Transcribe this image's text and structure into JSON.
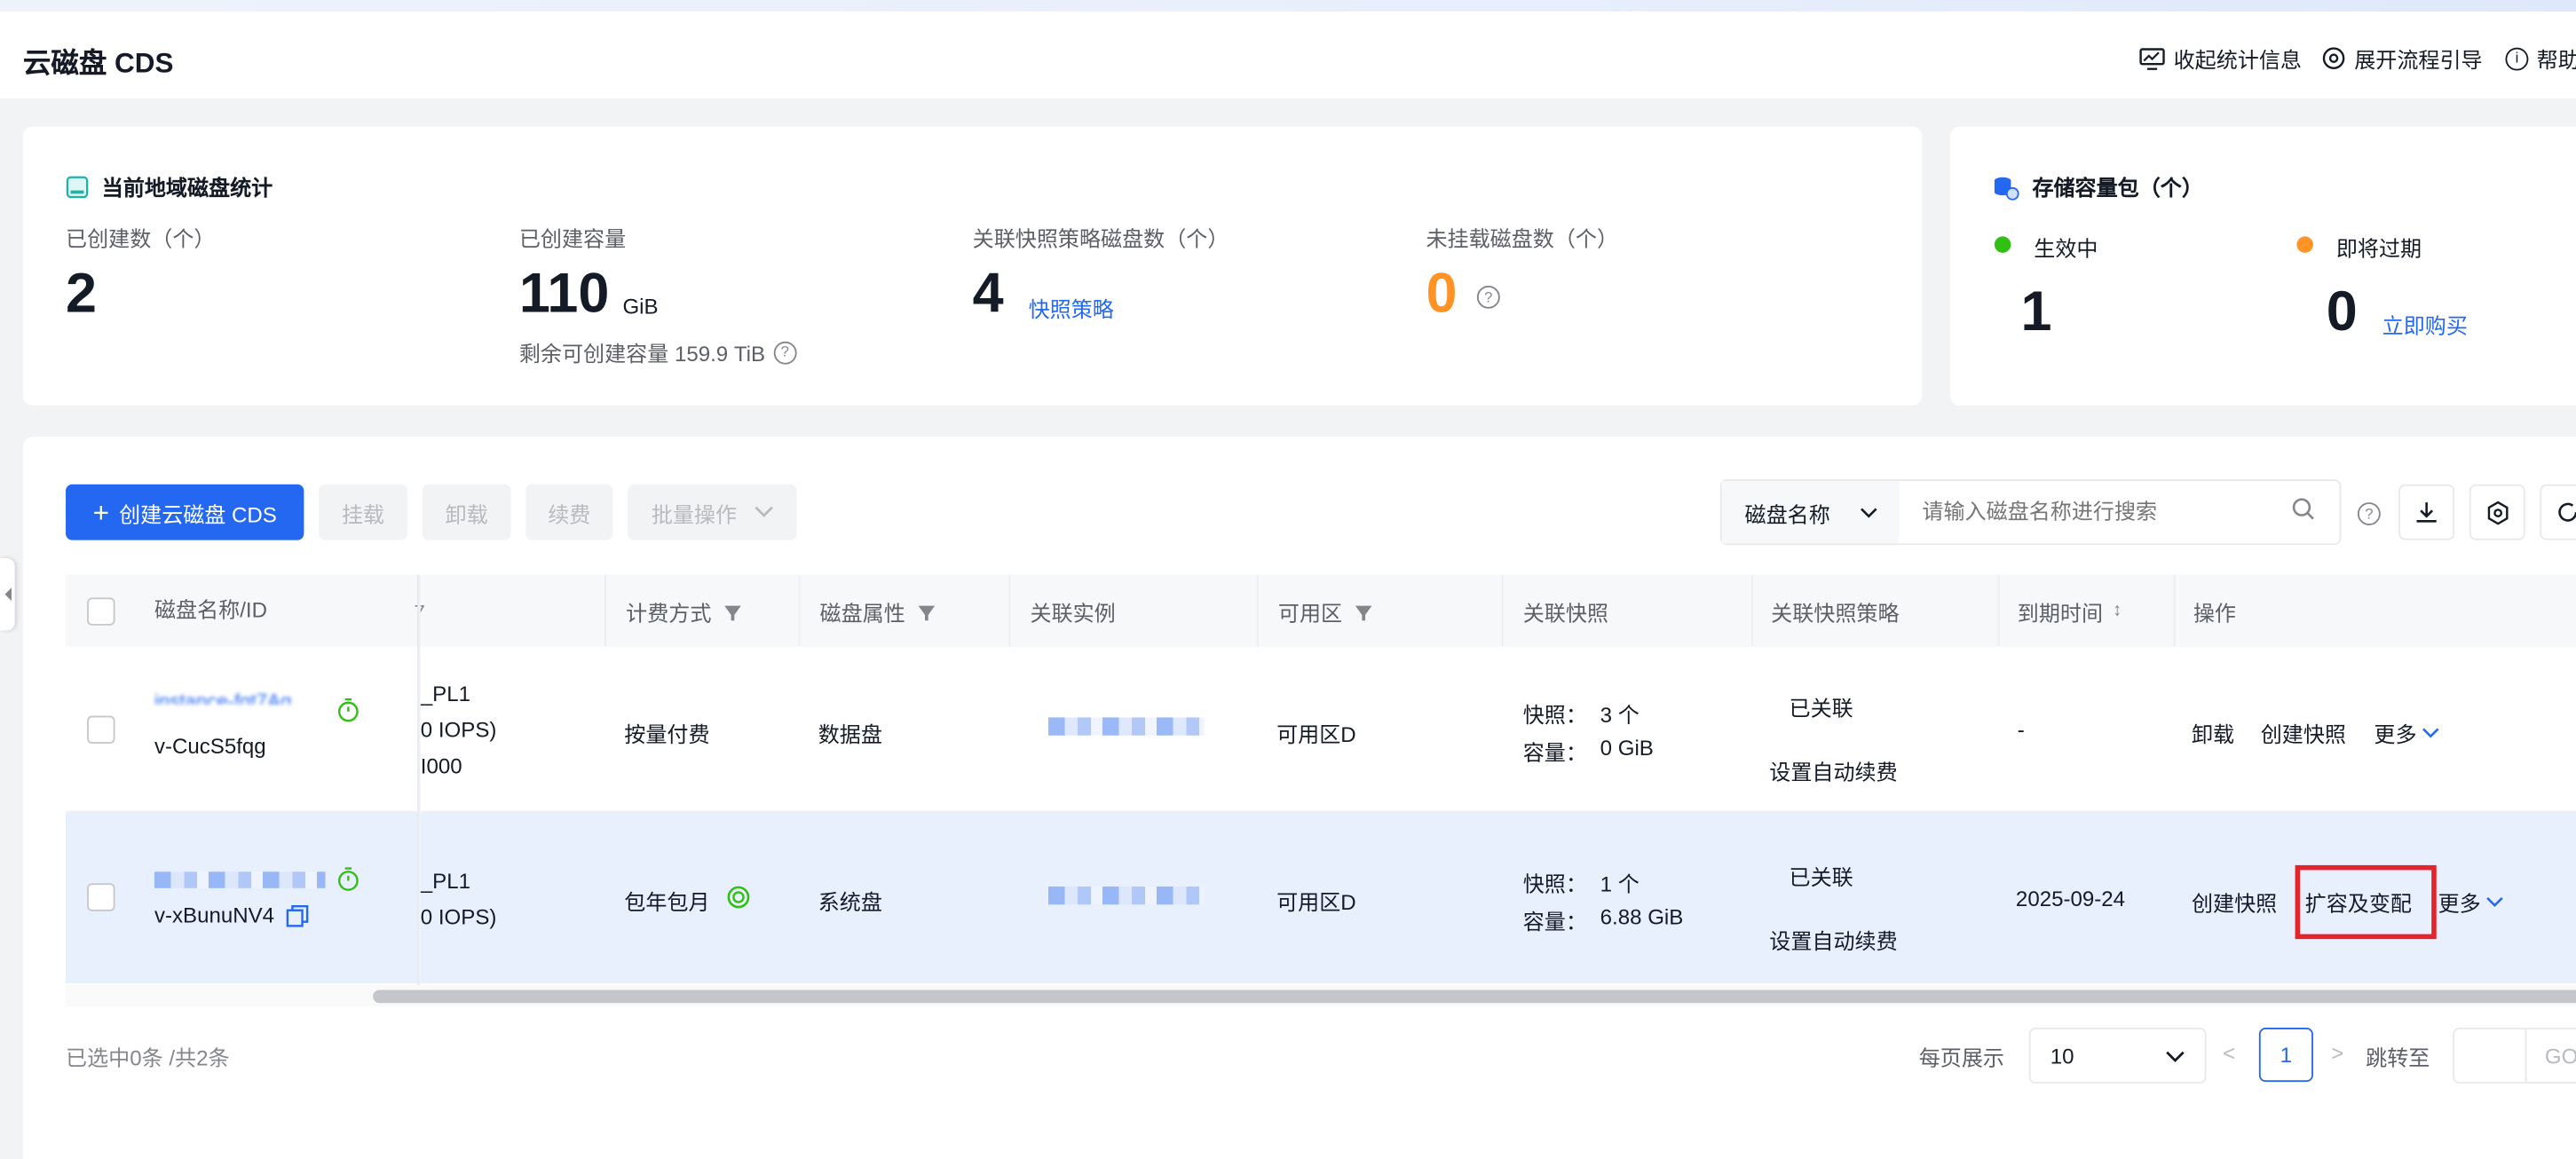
{
  "header": {
    "title": "云磁盘 CDS",
    "actions": [
      "收起统计信息",
      "展开流程引导",
      "帮助"
    ]
  },
  "stats": {
    "title": "当前地域磁盘统计",
    "created_count_label": "已创建数（个）",
    "created_count": "2",
    "created_capacity_label": "已创建容量",
    "created_capacity": "110",
    "created_capacity_unit": "GiB",
    "remaining_capacity": "剩余可创建容量 159.9 TiB",
    "snapshot_policy_label": "关联快照策略磁盘数（个）",
    "snapshot_policy_count": "4",
    "snapshot_policy_link": "快照策略",
    "unmounted_label": "未挂载磁盘数（个）",
    "unmounted_count": "0"
  },
  "storage_pack": {
    "title": "存储容量包（个）",
    "active_label": "生效中",
    "active_count": "1",
    "expiring_label": "即将过期",
    "expiring_count": "0",
    "buy_link": "立即购买"
  },
  "toolbar": {
    "create": "创建云磁盘 CDS",
    "mount": "挂载",
    "unmount": "卸载",
    "renew": "续费",
    "batch": "批量操作",
    "search_field": "磁盘名称",
    "search_placeholder": "请输入磁盘名称进行搜索"
  },
  "table": {
    "columns": {
      "name": "磁盘名称/ID",
      "billing": "计费方式",
      "attribute": "磁盘属性",
      "instance": "关联实例",
      "zone": "可用区",
      "snapshot": "关联快照",
      "policy": "关联快照策略",
      "expire": "到期时间",
      "ops": "操作"
    },
    "rows": [
      {
        "name_partial": "instance-fgt7Ag...",
        "id": "v-CucS5fqg",
        "type_line1": "_PL1",
        "type_line2": "0 IOPS)",
        "type_line3": "I000",
        "billing": "按量付费",
        "attribute": "数据盘",
        "zone": "可用区D",
        "snap_label": "快照：",
        "snap_count": "3 个",
        "cap_label": "容量：",
        "cap_value": "0 GiB",
        "policy_status": "已关联",
        "policy_link": "设置自动续费",
        "expire": "-",
        "op1": "卸载",
        "op2": "创建快照",
        "op3": "更多"
      },
      {
        "id": "v-xBunuNV4",
        "type_line1": "_PL1",
        "type_line2": "0 IOPS)",
        "billing": "包年包月",
        "attribute": "系统盘",
        "zone": "可用区D",
        "snap_label": "快照：",
        "snap_count": "1 个",
        "cap_label": "容量：",
        "cap_value": "6.88 GiB",
        "policy_status": "已关联",
        "policy_link": "设置自动续费",
        "expire": "2025-09-24",
        "op1": "创建快照",
        "op2": "扩容及变配",
        "op3": "更多"
      }
    ]
  },
  "footer": {
    "selected": "已选中0条 /共2条",
    "per_page_label": "每页展示",
    "per_page": "10",
    "current_page": "1",
    "jump_label": "跳转至",
    "go": "GO"
  },
  "colors": {
    "primary": "#2468f2",
    "orange": "#ff9326",
    "green": "#30bf13",
    "highlight_box": "#e5232b",
    "selected_row": "#e8f0fe"
  }
}
